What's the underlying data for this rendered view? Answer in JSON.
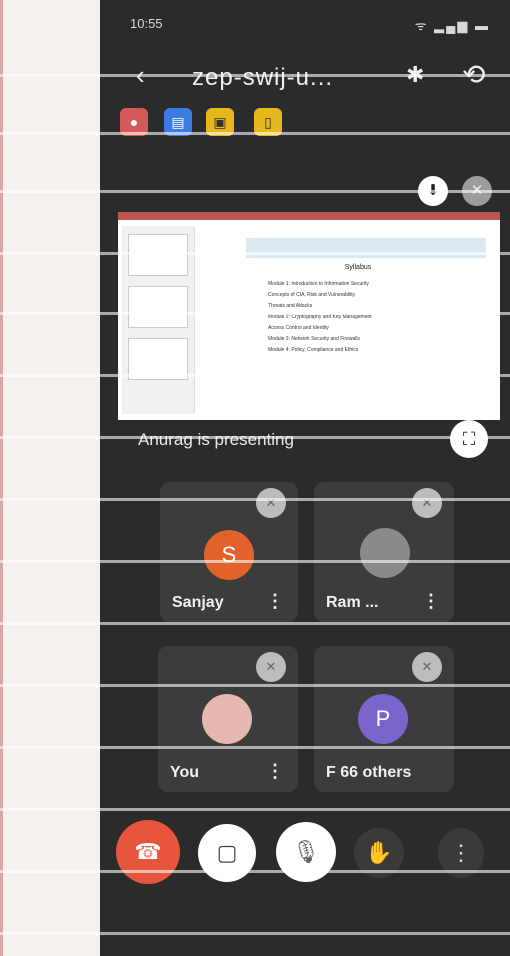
{
  "status_bar": {
    "time": "10:55",
    "icons": "ᯤ ▂▄▆ ▬"
  },
  "top_bar": {
    "back_icon": "back-arrow-icon",
    "meeting_code": "zep-swij-u...",
    "bluetooth_icon": "bluetooth-icon",
    "switch_camera_icon": "switch-camera-icon"
  },
  "notifications": [
    {
      "icon": "record-icon",
      "color": "#d45a5a"
    },
    {
      "icon": "doc-icon",
      "color": "#3d7be0"
    },
    {
      "icon": "slides-icon",
      "color": "#e6b81d"
    },
    {
      "icon": "slides-icon",
      "color": "#e6b81d"
    }
  ],
  "presentation": {
    "presenting_label": "Anurag is presenting",
    "doc_title": "Syllabus",
    "doc_lines": [
      "Module 1: Introduction to Information Security",
      "Concepts of CIA, Risk and Vulnerability",
      "Threats and Attacks",
      "Module 2: Cryptography and Key Management",
      "Access Control and Identity",
      "Module 3: Network Security and Firewalls",
      "Module 4: Policy, Compliance and Ethics"
    ]
  },
  "participants": [
    {
      "name": "Sanjay",
      "initial": "S",
      "avatar_color": "#e2622c"
    },
    {
      "name": "Ram ...",
      "initial": "",
      "avatar_color": "#8a8a8a"
    },
    {
      "name": "You",
      "initial": "",
      "avatar_color": "#e4b7b0"
    },
    {
      "name": "F  66 others",
      "initial": "P",
      "avatar_color": "#7a63c9"
    }
  ],
  "controls": {
    "end_call_icon": "end-call-icon",
    "camera_icon": "camera-off-icon",
    "mic_icon": "mic-off-icon",
    "raise_hand_icon": "raise-hand-icon",
    "more_icon": "more-vertical-icon"
  },
  "colors": {
    "end_call": "#e8553e",
    "background": "#2b2b2b"
  }
}
